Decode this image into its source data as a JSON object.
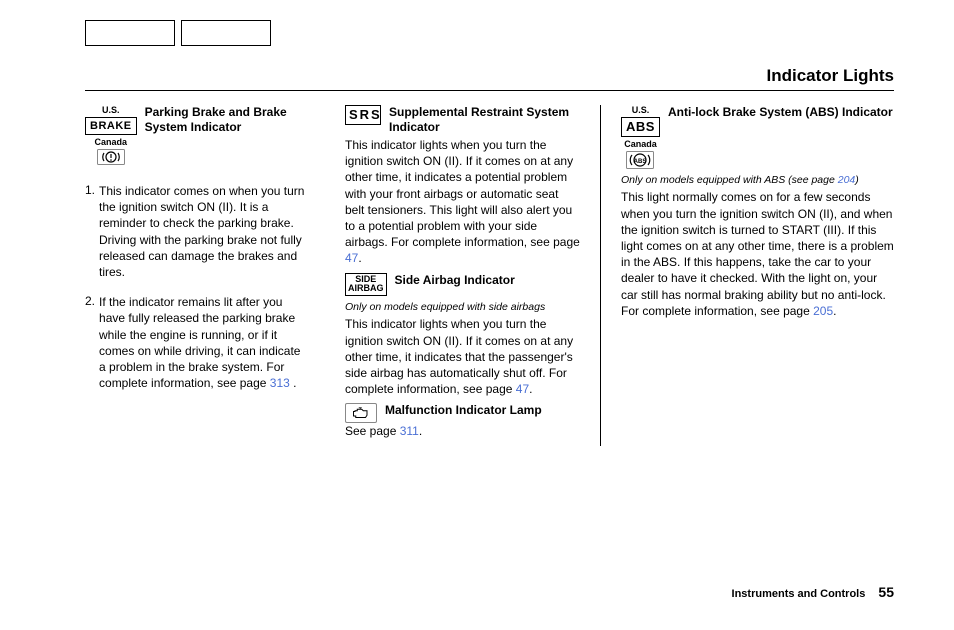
{
  "page_title": "Indicator Lights",
  "footer": {
    "section": "Instruments and Controls",
    "page": "55"
  },
  "col1": {
    "us_label": "U.S.",
    "brake_icon": "BRAKE",
    "canada_label": "Canada",
    "title": "Parking Brake and Brake System Indicator",
    "item1": "This indicator comes on when you turn the ignition switch ON (II). It is a reminder to check the parking brake. Driving with the parking brake not fully released can damage the brakes and tires.",
    "item2_a": "If the indicator remains lit after you have fully released the parking brake while the engine is running, or if it comes on while driving, it can indicate a problem in the brake system. For complete information, see page ",
    "item2_link": "313",
    "item2_b": " ."
  },
  "col2": {
    "srs_icon": "SRS",
    "srs_title": "Supplemental Restraint System Indicator",
    "srs_text_a": "This indicator lights when you turn the ignition switch ON (II). If it comes on at any other time, it indicates a potential problem with your front airbags or automatic seat belt tensioners. This light will also alert you to a potential problem with your side airbags. For complete information, see page ",
    "srs_link": "47",
    "srs_text_b": ".",
    "side_icon_l1": "SIDE",
    "side_icon_l2": "AIRBAG",
    "side_title": "Side Airbag Indicator",
    "side_note": "Only on models equipped with side airbags",
    "side_text_a": "This indicator lights when you turn the ignition switch ON (II). If it comes on at any other time, it indicates that the passenger's side airbag has automatically shut off. For complete information, see page ",
    "side_link": "47",
    "side_text_b": ".",
    "mil_title": "Malfunction Indicator Lamp",
    "mil_text_a": "See page ",
    "mil_link": "311",
    "mil_text_b": "."
  },
  "col3": {
    "us_label": "U.S.",
    "abs_icon": "ABS",
    "canada_label": "Canada",
    "title": "Anti-lock Brake System (ABS) Indicator",
    "note_a": "Only on models equipped with ABS (see page ",
    "note_link": "204",
    "note_b": ")",
    "text_a": "This light normally comes on for a few seconds when you turn the ignition switch ON (II), and when the ignition switch is turned to START (III). If this light comes on at any other time, there is a problem in the ABS. If this happens, take the car to your dealer to have it checked. With the light on, your car still has normal braking ability but no anti-lock. For complete information, see page ",
    "text_link": "205",
    "text_b": "."
  }
}
